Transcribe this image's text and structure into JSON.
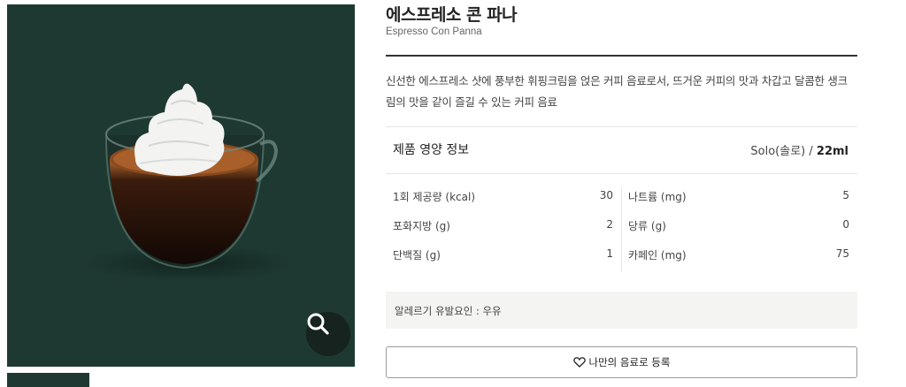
{
  "product": {
    "name_ko": "에스프레소 콘 파나",
    "name_en": "Espresso Con Panna",
    "description": "신선한 에스프레소 샷에 풍부한 휘핑크림을 얹은 커피 음료로서, 뜨거운 커피의 맛과 차갑고 달콤한 생크림의 맛을 같이 즐길 수 있는 커피 음료"
  },
  "image": {
    "background_color": "#1e3932",
    "zoom_icon": "search-icon"
  },
  "nutrition": {
    "title": "제품 영양 정보",
    "serving_size": "Solo(솔로) /",
    "serving_volume": "22ml",
    "left": [
      {
        "label": "1회 제공량 (kcal)",
        "value": "30"
      },
      {
        "label": "포화지방 (g)",
        "value": "2"
      },
      {
        "label": "단백질 (g)",
        "value": "1"
      }
    ],
    "right": [
      {
        "label": "나트륨 (mg)",
        "value": "5"
      },
      {
        "label": "당류 (g)",
        "value": "0"
      },
      {
        "label": "카페인 (mg)",
        "value": "75"
      }
    ]
  },
  "allergy": {
    "text": "알레르기 유발요인 : 우유"
  },
  "actions": {
    "my_menu_label": "나만의 음료로 등록",
    "my_menu_icon": "heart-icon"
  }
}
